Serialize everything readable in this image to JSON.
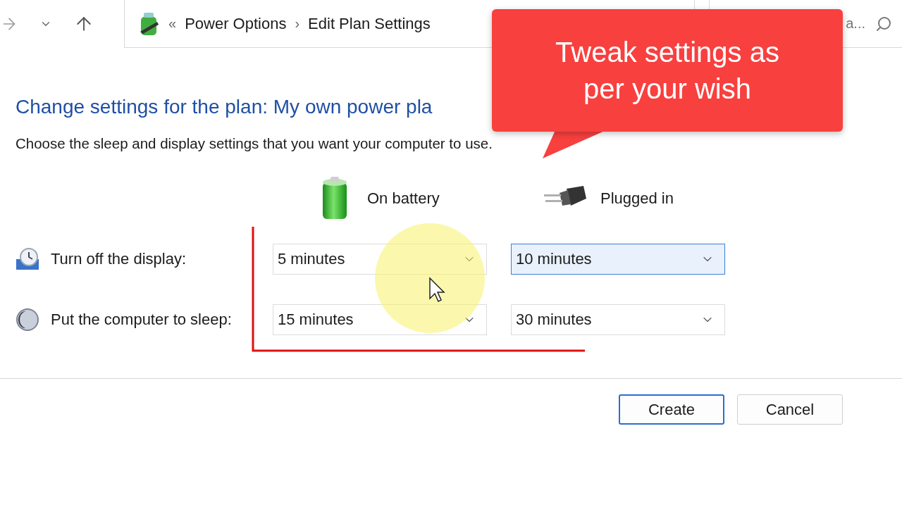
{
  "address_bar": {
    "breadcrumbs": [
      "Power Options",
      "Edit Plan Settings"
    ],
    "overflow": "«",
    "separator": "›"
  },
  "search": {
    "placeholder": "a..."
  },
  "title": "Change settings for the plan: My own power pla",
  "subtitle": "Choose the sleep and display settings that you want your computer to use.",
  "columns": [
    {
      "kind": "battery",
      "label": "On battery"
    },
    {
      "kind": "plug",
      "label": "Plugged in"
    }
  ],
  "settings": [
    {
      "kind": "display",
      "label": "Turn off the display:",
      "values": [
        {
          "value": "5 minutes",
          "focused": false
        },
        {
          "value": "10 minutes",
          "focused": true
        }
      ]
    },
    {
      "kind": "sleep",
      "label": "Put the computer to sleep:",
      "values": [
        {
          "value": "15 minutes",
          "focused": false
        },
        {
          "value": "30 minutes",
          "focused": false
        }
      ]
    }
  ],
  "buttons": [
    {
      "label": "Create",
      "default": true
    },
    {
      "label": "Cancel",
      "default": false
    }
  ],
  "callout": {
    "lines": [
      "Tweak settings as",
      "per your wish"
    ]
  }
}
